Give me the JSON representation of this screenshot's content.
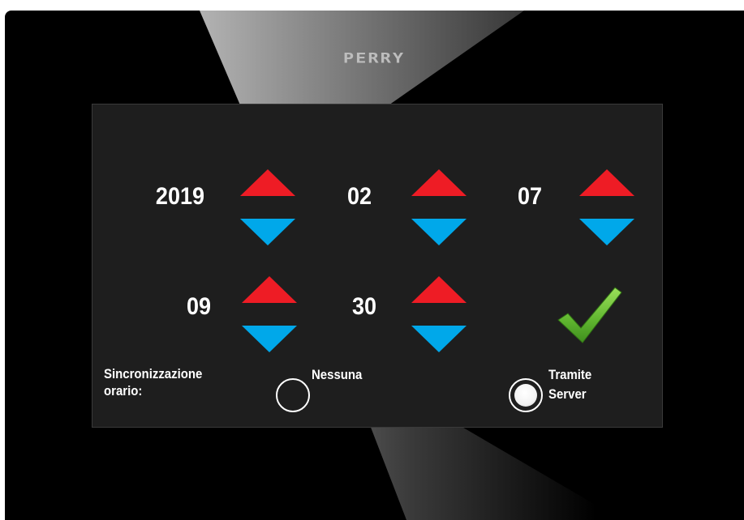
{
  "brand": {
    "logo_text": "PERRY"
  },
  "datetime": {
    "year": "2019",
    "month": "02",
    "day": "07",
    "hour": "09",
    "minute": "30"
  },
  "sync": {
    "label_line1": "Sincronizzazione",
    "label_line2": "orario:",
    "options": [
      {
        "label": "Nessuna",
        "selected": false
      },
      {
        "label_line1": "Tramite",
        "label_line2": "Server",
        "selected": true
      }
    ]
  },
  "colors": {
    "increment_arrow": "#ee1c25",
    "decrement_arrow": "#00a8ea",
    "confirm_check": "#6abf3b"
  },
  "icons": {
    "increment": "triangle-up-icon",
    "decrement": "triangle-down-icon",
    "confirm": "checkmark-icon"
  }
}
